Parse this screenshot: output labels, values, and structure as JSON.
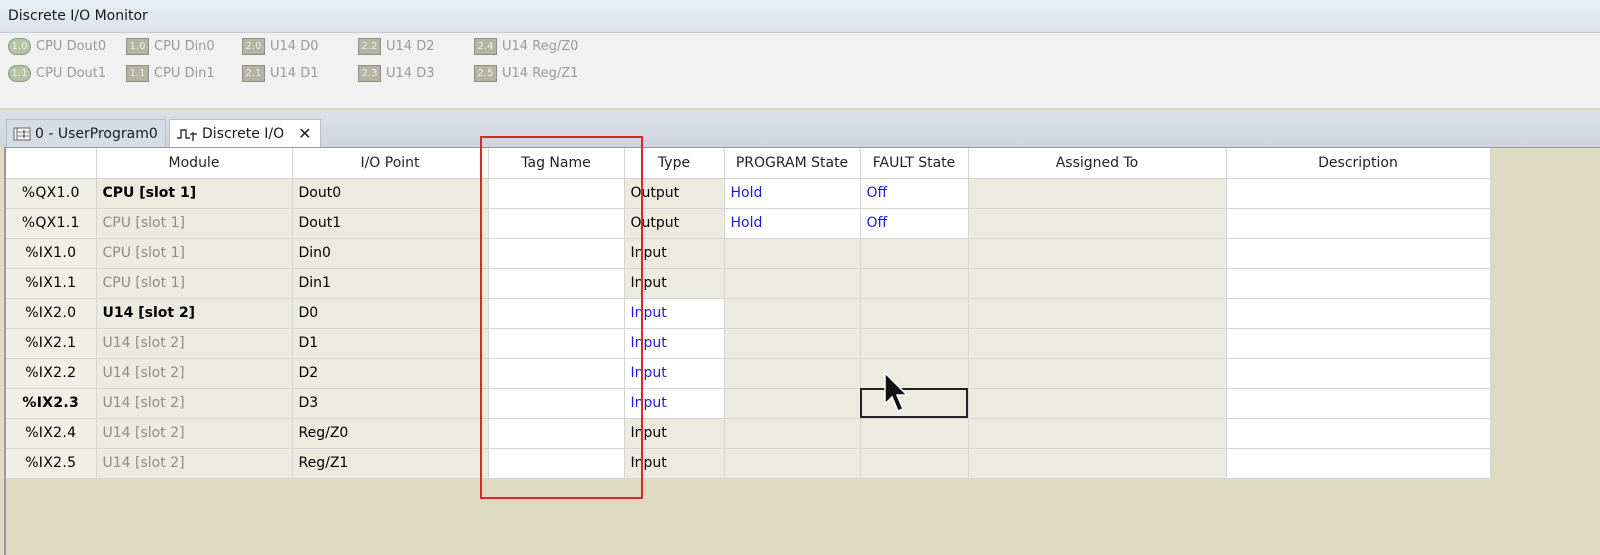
{
  "monitor": {
    "title": "Discrete I/O Monitor",
    "leds": [
      {
        "ind": "1.0",
        "label": "CPU Dout0",
        "round": true
      },
      {
        "ind": "1.1",
        "label": "CPU Dout1",
        "round": true
      },
      {
        "ind": "1.0",
        "label": "CPU Din0",
        "round": false
      },
      {
        "ind": "1.1",
        "label": "CPU Din1",
        "round": false
      },
      {
        "ind": "2.0",
        "label": "U14 D0",
        "round": false
      },
      {
        "ind": "2.1",
        "label": "U14 D1",
        "round": false
      },
      {
        "ind": "2.2",
        "label": "U14 D2",
        "round": false
      },
      {
        "ind": "2.3",
        "label": "U14 D3",
        "round": false
      },
      {
        "ind": "2.4",
        "label": "U14 Reg/Z0",
        "round": false
      },
      {
        "ind": "2.5",
        "label": "U14 Reg/Z1",
        "round": false
      }
    ]
  },
  "tabs": [
    {
      "label": "0 - UserProgram0",
      "active": false
    },
    {
      "label": "Discrete I/O",
      "active": true,
      "close": "✕"
    }
  ],
  "table": {
    "headers": [
      "",
      "Module",
      "I/O Point",
      "Tag Name",
      "Type",
      "PROGRAM State",
      "FAULT State",
      "Assigned To",
      "Description"
    ],
    "rows": [
      {
        "addr": "%QX1.0",
        "module": "CPU [slot 1]",
        "moduleBold": true,
        "point": "Dout0",
        "tag": "",
        "type": "Output",
        "program": "Hold",
        "fault": "Off",
        "assigned": "",
        "desc": ""
      },
      {
        "addr": "%QX1.1",
        "module": "CPU [slot 1]",
        "moduleBold": false,
        "point": "Dout1",
        "tag": "",
        "type": "Output",
        "program": "Hold",
        "fault": "Off",
        "assigned": "",
        "desc": ""
      },
      {
        "addr": "%IX1.0",
        "module": "CPU [slot 1]",
        "moduleBold": false,
        "point": "Din0",
        "tag": "",
        "type": "Input",
        "program": "",
        "fault": "",
        "assigned": "",
        "desc": ""
      },
      {
        "addr": "%IX1.1",
        "module": "CPU [slot 1]",
        "moduleBold": false,
        "point": "Din1",
        "tag": "",
        "type": "Input",
        "program": "",
        "fault": "",
        "assigned": "",
        "desc": ""
      },
      {
        "addr": "%IX2.0",
        "module": "U14 [slot 2]",
        "moduleBold": true,
        "point": "D0",
        "tag": "",
        "type": "Input",
        "program": "",
        "fault": "",
        "assigned": "",
        "desc": ""
      },
      {
        "addr": "%IX2.1",
        "module": "U14 [slot 2]",
        "moduleBold": false,
        "point": "D1",
        "tag": "",
        "type": "Input",
        "program": "",
        "fault": "",
        "assigned": "",
        "desc": ""
      },
      {
        "addr": "%IX2.2",
        "module": "U14 [slot 2]",
        "moduleBold": false,
        "point": "D2",
        "tag": "",
        "type": "Input",
        "program": "",
        "fault": "",
        "assigned": "",
        "desc": ""
      },
      {
        "addr": "%IX2.3",
        "module": "U14 [slot 2]",
        "moduleBold": false,
        "point": "D3",
        "tag": "",
        "type": "Input",
        "program": "",
        "fault": "",
        "assigned": "",
        "desc": ""
      },
      {
        "addr": "%IX2.4",
        "module": "U14 [slot 2]",
        "moduleBold": false,
        "point": "Reg/Z0",
        "tag": "",
        "type": "Input",
        "program": "",
        "fault": "",
        "assigned": "",
        "desc": ""
      },
      {
        "addr": "%IX2.5",
        "module": "U14 [slot 2]",
        "moduleBold": false,
        "point": "Reg/Z1",
        "tag": "",
        "type": "Input",
        "program": "",
        "fault": "",
        "assigned": "",
        "desc": ""
      }
    ]
  },
  "colors": {
    "accent_blue": "#1a1ae0",
    "highlight_red": "#d82828"
  }
}
